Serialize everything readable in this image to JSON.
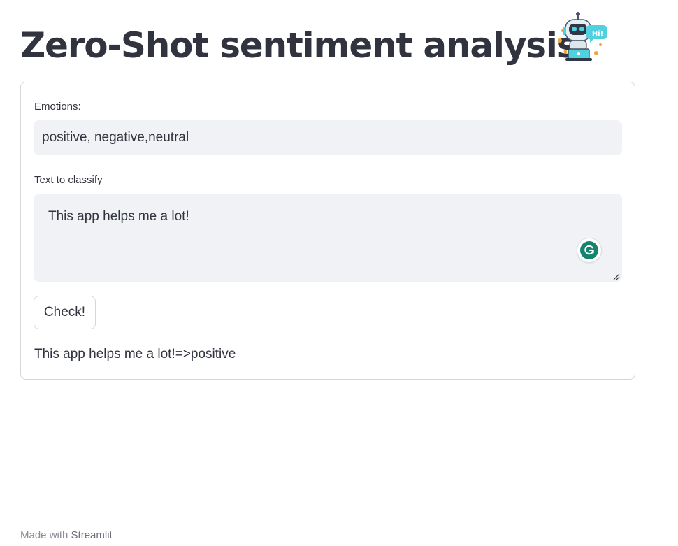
{
  "page": {
    "title": "Zero-Shot sentiment analysis",
    "logo": {
      "icon": "robot-hi-icon",
      "badge_text": "Hi!"
    }
  },
  "form": {
    "emotions": {
      "label": "Emotions:",
      "value": "positive, negative,neutral"
    },
    "text_to_classify": {
      "label": "Text to classify",
      "value": "This app helps me a lot!"
    },
    "check_button": {
      "label": "Check!"
    },
    "result": "This app helps me a lot!=>positive"
  },
  "footer": {
    "prefix": "Made with",
    "link": "Streamlit"
  },
  "colors": {
    "text": "#31333f",
    "input_bg": "#f0f2f6",
    "border": "#d6d6d9",
    "grammarly": "#15846e"
  }
}
